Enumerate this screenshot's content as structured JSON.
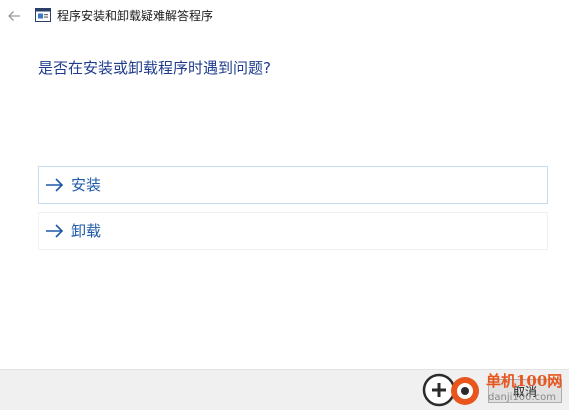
{
  "window": {
    "title": "程序安装和卸载疑难解答程序"
  },
  "main": {
    "heading": "是否在安装或卸载程序时遇到问题?",
    "options": [
      {
        "label": "安装",
        "icon": "arrow-right-icon"
      },
      {
        "label": "卸载",
        "icon": "arrow-right-icon"
      }
    ]
  },
  "footer": {
    "cancel_label": "取消"
  },
  "watermark": {
    "brand": "单机100网",
    "url": "danji100.com"
  },
  "colors": {
    "heading": "#1f3d8c",
    "option_text": "#1f5aa8",
    "option_border": "#c6dcef",
    "footer_bg": "#f0f0f0",
    "watermark": "#e8561e"
  }
}
